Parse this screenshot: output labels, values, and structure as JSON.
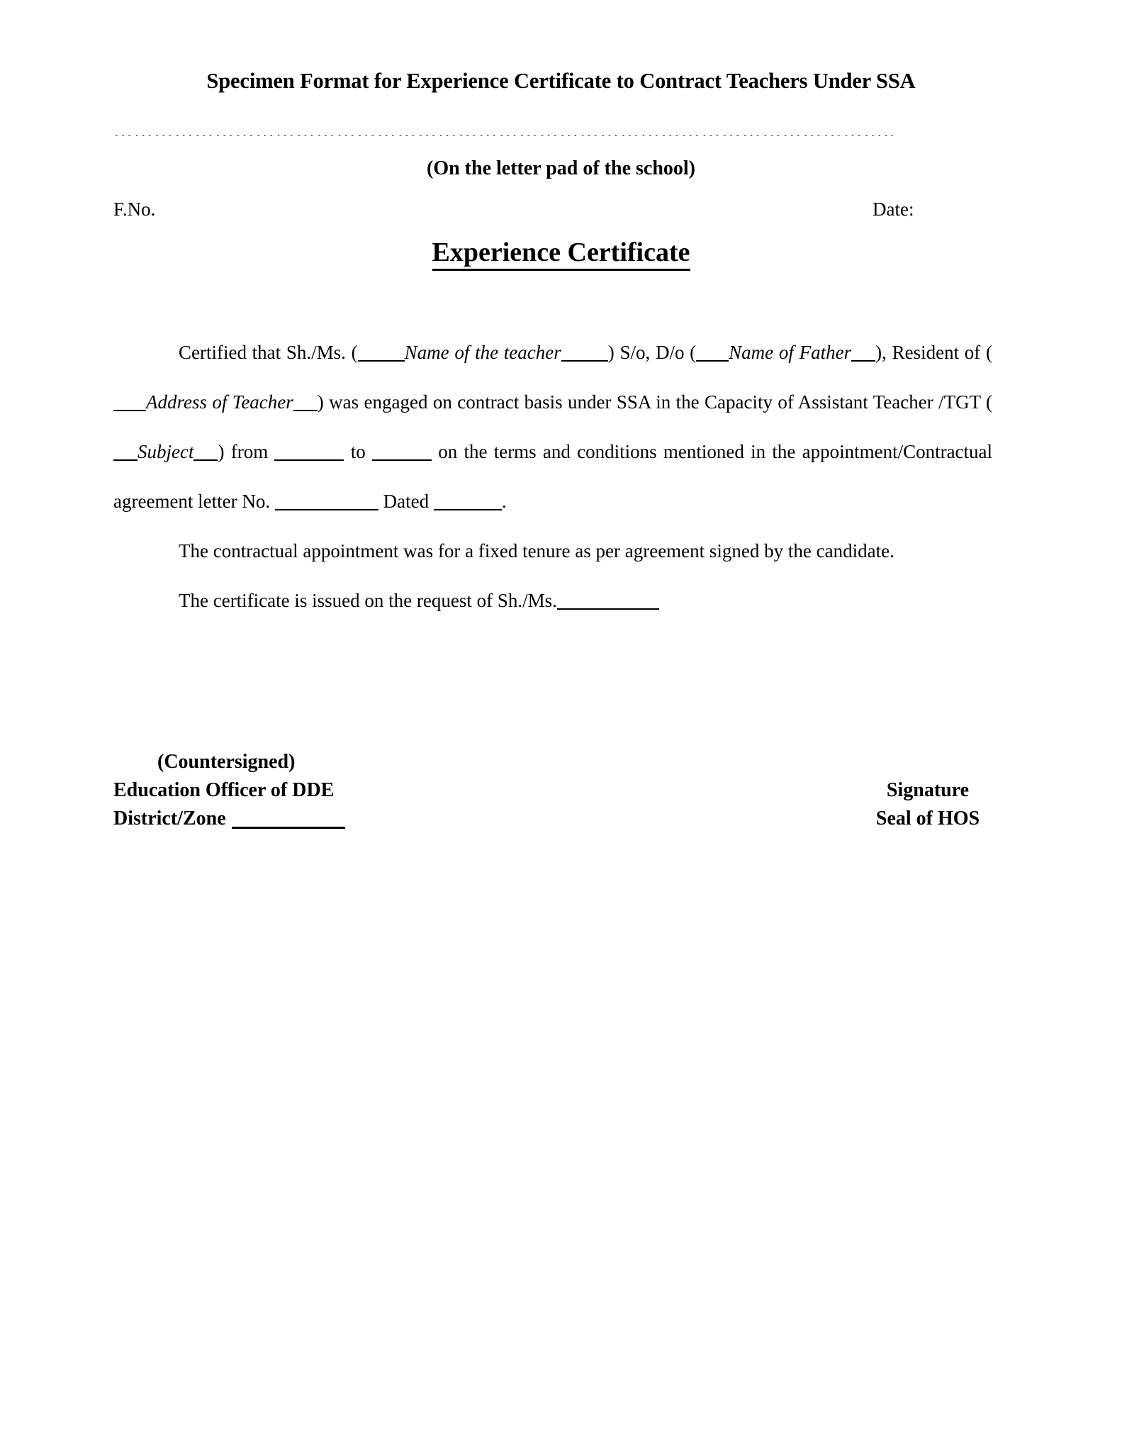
{
  "document": {
    "title": "Specimen Format for Experience Certificate to Contract Teachers Under SSA",
    "dotted_rule": "……………………………………………………………………………………………………..",
    "letterpad_note": "(On the letter pad of the school)",
    "file_no_label": "F.No.",
    "date_label": "Date:",
    "certificate_heading": "Experience Certificate"
  },
  "body": {
    "para1": {
      "seg1": "Certified that Sh./Ms. (",
      "italic1": "Name of the teacher",
      "seg2": ") S/o, D/o (",
      "italic2": "Name of Father",
      "seg3": "),",
      "seg4": "Resident of (",
      "italic3": "Address of Teacher",
      "seg5": ") was engaged on contract basis under SSA in the Capacity of Assistant Teacher /TGT (",
      "italic4": "Subject",
      "seg6": ") from",
      "seg7": "to",
      "seg8": "on the terms and conditions mentioned in the appointment/Contractual agreement letter No.",
      "seg9": "Dated",
      "seg10": "."
    },
    "para2": "The contractual appointment was for a fixed tenure as per agreement signed by the candidate.",
    "para3": {
      "text": "The certificate is issued on the request of Sh./Ms."
    }
  },
  "signature": {
    "countersigned": "(Countersigned)",
    "officer": "Education Officer of DDE",
    "district_zone_label": "District/Zone",
    "right_line1": "Signature",
    "right_line2": "Seal of HOS"
  },
  "colors": {
    "text": "#000000",
    "page_background": "#ffffff"
  }
}
